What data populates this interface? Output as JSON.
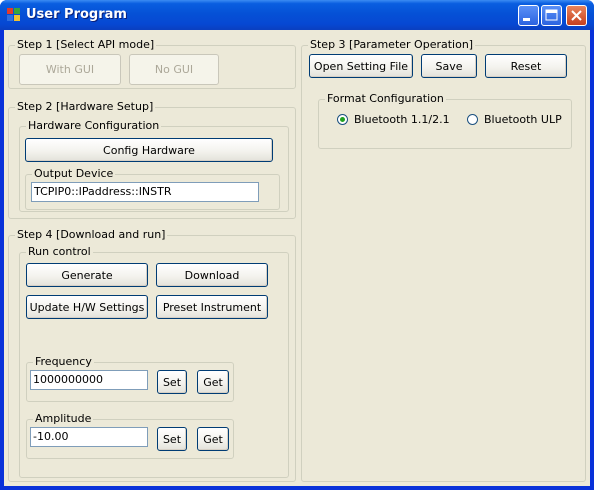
{
  "window": {
    "title": "User Program"
  },
  "step1": {
    "legend": "Step 1 [Select API mode]",
    "with_gui": "With GUI",
    "no_gui": "No GUI"
  },
  "step2": {
    "legend": "Step 2 [Hardware Setup]",
    "hw_config_legend": "Hardware Configuration",
    "config_button": "Config Hardware",
    "output_device_legend": "Output Device",
    "output_device_value": "TCPIP0::IPaddress::INSTR"
  },
  "step3": {
    "legend": "Step 3 [Parameter Operation]",
    "open_button": "Open Setting File",
    "save_button": "Save",
    "reset_button": "Reset",
    "format_legend": "Format Configuration",
    "radio_bt": "Bluetooth 1.1/2.1",
    "radio_ble": "Bluetooth ULP",
    "selected": "Bluetooth 1.1/2.1"
  },
  "step4": {
    "legend": "Step 4 [Download and run]",
    "run_control_legend": "Run control",
    "generate": "Generate",
    "download": "Download",
    "update_hw": "Update H/W Settings",
    "preset": "Preset Instrument",
    "frequency": {
      "legend": "Frequency",
      "value": "1000000000",
      "set": "Set",
      "get": "Get"
    },
    "amplitude": {
      "legend": "Amplitude",
      "value": "-10.00",
      "set": "Set",
      "get": "Get"
    }
  }
}
